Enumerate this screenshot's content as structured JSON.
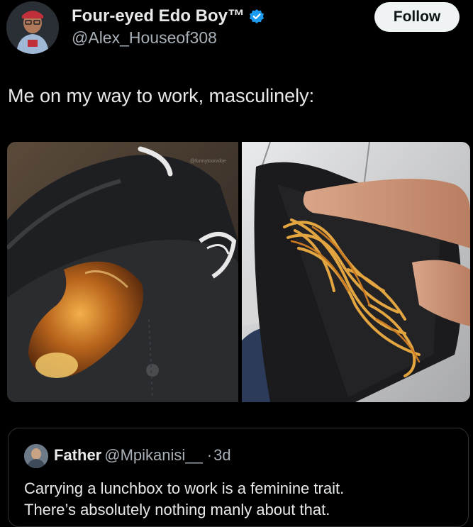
{
  "author": {
    "display_name": "Four-eyed Edo Boy™",
    "handle": "@Alex_Houseof308",
    "verified": true,
    "avatar_icon": "profile-photo-icon"
  },
  "follow_button": {
    "label": "Follow"
  },
  "tweet": {
    "text": "Me on my way to work, masculinely:"
  },
  "media": {
    "left_photo_icon": "chicken-drumstick-in-pocket-photo",
    "right_photo_icon": "spaghetti-in-wallet-photo"
  },
  "quoted_tweet": {
    "name": "Father",
    "handle": "@Mpikanisi__",
    "separator": "·",
    "time": "3d",
    "text_lines": [
      "Carrying a lunchbox to work is a feminine trait.",
      "There’s absolutely nothing manly about that."
    ],
    "avatar_icon": "profile-photo-icon"
  },
  "colors": {
    "background": "#000000",
    "text_primary": "#e7e9ea",
    "text_secondary": "#a8b0b8",
    "verified_blue": "#1d9bf0",
    "follow_bg": "#eff3f4",
    "border": "#2f3336"
  }
}
